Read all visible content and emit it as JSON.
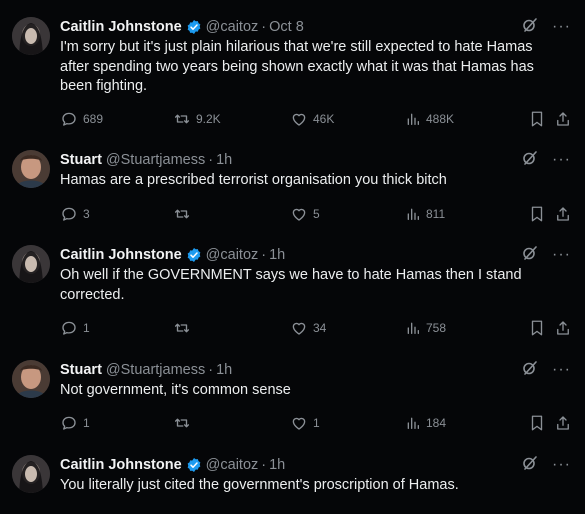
{
  "tweets": [
    {
      "name": "Caitlin Johnstone",
      "verified": true,
      "handle": "@caitoz",
      "dot": "·",
      "time": "Oct 8",
      "text": "I'm sorry but it's just plain hilarious that we're still expected to hate Hamas after spending two years being shown exactly what it was that Hamas has been fighting.",
      "replies": "689",
      "retweets": "9.2K",
      "likes": "46K",
      "views": "488K"
    },
    {
      "name": "Stuart",
      "verified": false,
      "handle": "@Stuartjamess",
      "dot": "·",
      "time": "1h",
      "text": "Hamas are a prescribed terrorist organisation you thick bitch",
      "replies": "3",
      "retweets": "",
      "likes": "5",
      "views": "811"
    },
    {
      "name": "Caitlin Johnstone",
      "verified": true,
      "handle": "@caitoz",
      "dot": "·",
      "time": "1h",
      "text": "Oh well if the GOVERNMENT says we have to hate Hamas then I stand corrected.",
      "replies": "1",
      "retweets": "",
      "likes": "34",
      "views": "758"
    },
    {
      "name": "Stuart",
      "verified": false,
      "handle": "@Stuartjamess",
      "dot": "·",
      "time": "1h",
      "text": "Not government, it's common sense",
      "replies": "1",
      "retweets": "",
      "likes": "1",
      "views": "184"
    },
    {
      "name": "Caitlin Johnstone",
      "verified": true,
      "handle": "@caitoz",
      "dot": "·",
      "time": "1h",
      "text": "You literally just cited the government's proscription of Hamas.",
      "replies": "",
      "retweets": "",
      "likes": "",
      "views": ""
    }
  ],
  "icons": {
    "reply": "reply-icon",
    "retweet": "retweet-icon",
    "like": "heart-icon",
    "views": "views-icon",
    "bookmark": "bookmark-icon",
    "share": "share-icon",
    "grok": "grok-icon",
    "more": "more-icon",
    "verified": "verified-badge-icon"
  },
  "colors": {
    "background": "#050608",
    "text": "#e7e9ea",
    "muted": "#8b9096",
    "verified": "#1d9bf0"
  }
}
